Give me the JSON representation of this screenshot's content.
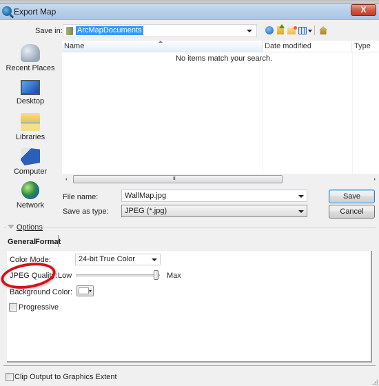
{
  "window": {
    "title": "Export Map",
    "close_label": "X",
    "app_icon": "arcmap-globe-icon"
  },
  "save_in": {
    "label": "Save in:",
    "value": "ArcMapDocuments",
    "folder_icon": "library-folder-icon"
  },
  "toolbar": {
    "icons": [
      "back-icon",
      "up-folder-icon",
      "new-folder-icon",
      "views-menu-icon",
      "home-icon"
    ]
  },
  "places": [
    {
      "label": "Recent Places",
      "icon": "recent-places-icon"
    },
    {
      "label": "Desktop",
      "icon": "desktop-icon"
    },
    {
      "label": "Libraries",
      "icon": "libraries-icon"
    },
    {
      "label": "Computer",
      "icon": "computer-icon"
    },
    {
      "label": "Network",
      "icon": "network-icon"
    }
  ],
  "file_list": {
    "columns": [
      "Name",
      "Date modified",
      "Type"
    ],
    "sorted_by": "Name",
    "empty_message": "No items match your search.",
    "scroll_grip": "III"
  },
  "file_name": {
    "label": "File name:",
    "value": "WallMap.jpg"
  },
  "save_as_type": {
    "label": "Save as type:",
    "value": "JPEG (*.jpg)"
  },
  "buttons": {
    "save": "Save",
    "cancel": "Cancel"
  },
  "options": {
    "label": "Options",
    "expanded": true,
    "tabs": [
      {
        "label": "General",
        "active": false
      },
      {
        "label": "Format",
        "active": true
      }
    ],
    "color_mode": {
      "label": "Color Mode:",
      "value": "24-bit True Color"
    },
    "jpeg_quality": {
      "label": "JPEG Quality:",
      "low_label": "Low",
      "max_label": "Max",
      "value_fraction": 0.98,
      "highlighted": true,
      "highlight_color": "#d8101a"
    },
    "background_color": {
      "label": "Background Color:",
      "value": "#ffffff"
    },
    "progressive": {
      "label": "Progressive",
      "checked": false
    }
  },
  "clip_output": {
    "label": "Clip Output to Graphics Extent",
    "checked": false
  }
}
